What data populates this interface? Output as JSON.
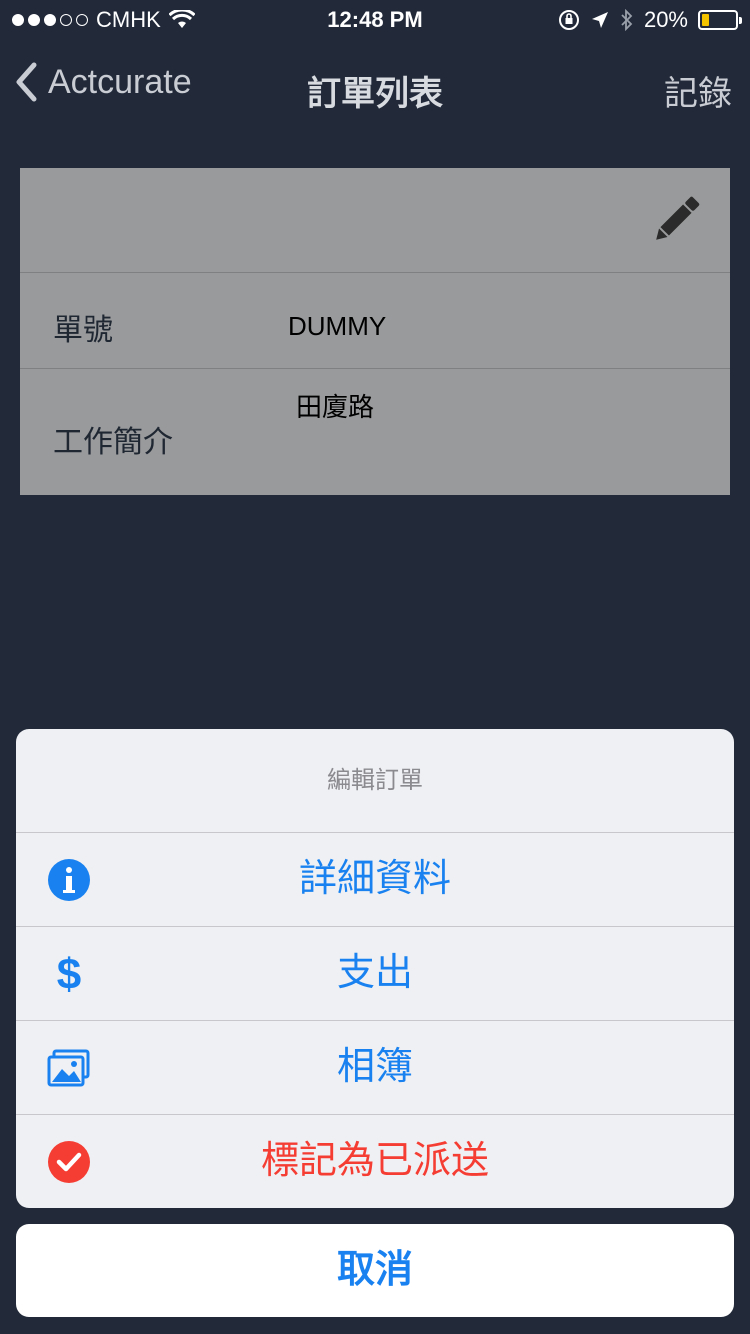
{
  "status_bar": {
    "carrier": "CMHK",
    "time": "12:48 PM",
    "battery": "20%",
    "battery_level": 0.2
  },
  "nav": {
    "back_label": "Actcurate",
    "title": "訂單列表",
    "right_label": "記錄"
  },
  "card": {
    "order_no_label": "單號",
    "order_no_value": "DUMMY",
    "job_label": "工作簡介",
    "job_value": "田廈路"
  },
  "action_sheet": {
    "title": "編輯訂單",
    "actions": [
      {
        "label": "詳細資料",
        "icon": "info-icon",
        "color": "#1a82f0"
      },
      {
        "label": "支出",
        "icon": "dollar-icon",
        "color": "#1a82f0"
      },
      {
        "label": "相簿",
        "icon": "photo-album-icon",
        "color": "#1a82f0"
      },
      {
        "label": "標記為已派送",
        "icon": "checkmark-circle-icon",
        "color": "#f53d33"
      }
    ],
    "cancel_label": "取消"
  },
  "colors": {
    "background": "#222a3a",
    "accent": "#1a82f0",
    "destructive": "#f53d33"
  }
}
